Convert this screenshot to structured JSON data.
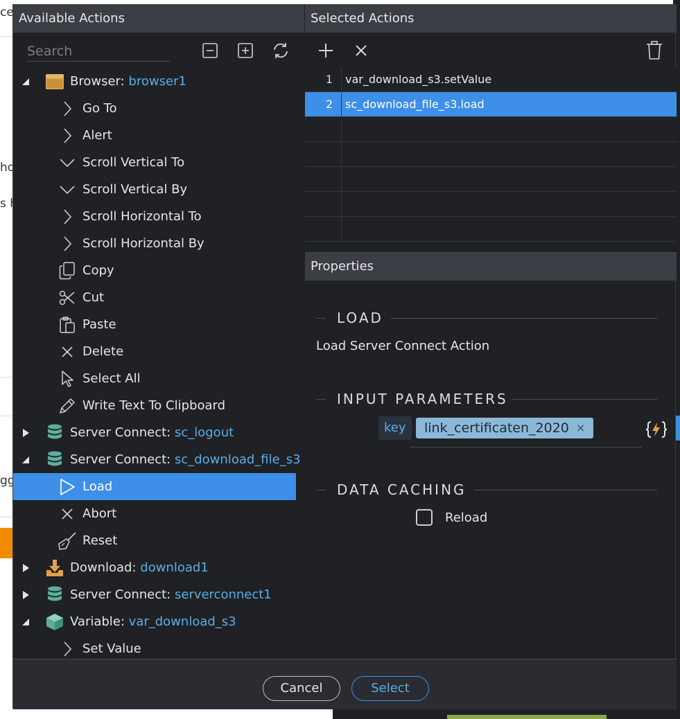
{
  "background": {
    "fragments": [
      "ce",
      "ho",
      "s h",
      "gg"
    ],
    "accent_orange": "#f08a00"
  },
  "left_panel": {
    "title": "Available Actions",
    "search_placeholder": "Search",
    "toolbar": {
      "collapse_icon": "minus-square-icon",
      "expand_icon": "plus-square-icon",
      "refresh_icon": "refresh-icon"
    },
    "tree": [
      {
        "label": "Browser: ",
        "name": "browser1",
        "icon": "browser-window-icon",
        "toggle": "expanded",
        "level": 0
      },
      {
        "label": "Go To",
        "icon": "chevron-right-icon",
        "level": 1
      },
      {
        "label": "Alert",
        "icon": "chevron-right-icon",
        "level": 1
      },
      {
        "label": "Scroll Vertical To",
        "icon": "chevron-down-icon",
        "level": 1
      },
      {
        "label": "Scroll Vertical By",
        "icon": "chevron-down-icon",
        "level": 1
      },
      {
        "label": "Scroll Horizontal To",
        "icon": "chevron-right-icon",
        "level": 1
      },
      {
        "label": "Scroll Horizontal By",
        "icon": "chevron-right-icon",
        "level": 1
      },
      {
        "label": "Copy",
        "icon": "copy-icon",
        "level": 1
      },
      {
        "label": "Cut",
        "icon": "scissors-icon",
        "level": 1
      },
      {
        "label": "Paste",
        "icon": "paste-icon",
        "level": 1
      },
      {
        "label": "Delete",
        "icon": "x-icon",
        "level": 1
      },
      {
        "label": "Select All",
        "icon": "cursor-icon",
        "level": 1
      },
      {
        "label": "Write Text To Clipboard",
        "icon": "pencil-icon",
        "level": 1
      },
      {
        "label": "Server Connect: ",
        "name": "sc_logout",
        "icon": "database-icon",
        "toggle": "collapsed",
        "level": 0
      },
      {
        "label": "Server Connect: ",
        "name": "sc_download_file_s3",
        "icon": "database-icon",
        "toggle": "expanded",
        "level": 0
      },
      {
        "label": "Load",
        "icon": "play-icon",
        "level": 1,
        "selected": true
      },
      {
        "label": "Abort",
        "icon": "x-icon",
        "level": 1
      },
      {
        "label": "Reset",
        "icon": "broom-icon",
        "level": 1
      },
      {
        "label": "Download: ",
        "name": "download1",
        "icon": "download-icon",
        "toggle": "collapsed",
        "level": 0
      },
      {
        "label": "Server Connect: ",
        "name": "serverconnect1",
        "icon": "database-icon",
        "toggle": "collapsed",
        "level": 0
      },
      {
        "label": "Variable: ",
        "name": "var_download_s3",
        "icon": "cube-icon",
        "toggle": "expanded",
        "level": 0
      },
      {
        "label": "Set Value",
        "icon": "chevron-right-icon",
        "level": 1
      }
    ]
  },
  "selected_actions": {
    "title": "Selected Actions",
    "toolbar": {
      "add_icon": "plus-icon",
      "remove_icon": "x-icon",
      "trash_icon": "trash-icon"
    },
    "rows": [
      {
        "num": "1",
        "action": "var_download_s3.setValue",
        "selected": false
      },
      {
        "num": "2",
        "action": "sc_download_file_s3.load",
        "selected": true
      },
      {
        "num": "",
        "action": "",
        "selected": false
      },
      {
        "num": "",
        "action": "",
        "selected": false
      },
      {
        "num": "",
        "action": "",
        "selected": false
      },
      {
        "num": "",
        "action": "",
        "selected": false
      },
      {
        "num": "",
        "action": "",
        "selected": false
      }
    ]
  },
  "properties": {
    "title": "Properties",
    "section_load": "LOAD",
    "description": "Load Server Connect Action",
    "section_input": "INPUT PARAMETERS",
    "param_key": "key",
    "param_value": "link_certificaten_2020",
    "tag_remove": "×",
    "dynamic_icon": "dynamic-data-icon",
    "section_caching": "DATA CACHING",
    "reload_label": "Reload",
    "reload_checked": false
  },
  "footer": {
    "cancel_label": "Cancel",
    "select_label": "Select"
  },
  "colors": {
    "selection": "#3d8fe8",
    "link": "#5aaee6",
    "panel_bg": "#1f2125",
    "header_bg": "#3b3e44"
  }
}
